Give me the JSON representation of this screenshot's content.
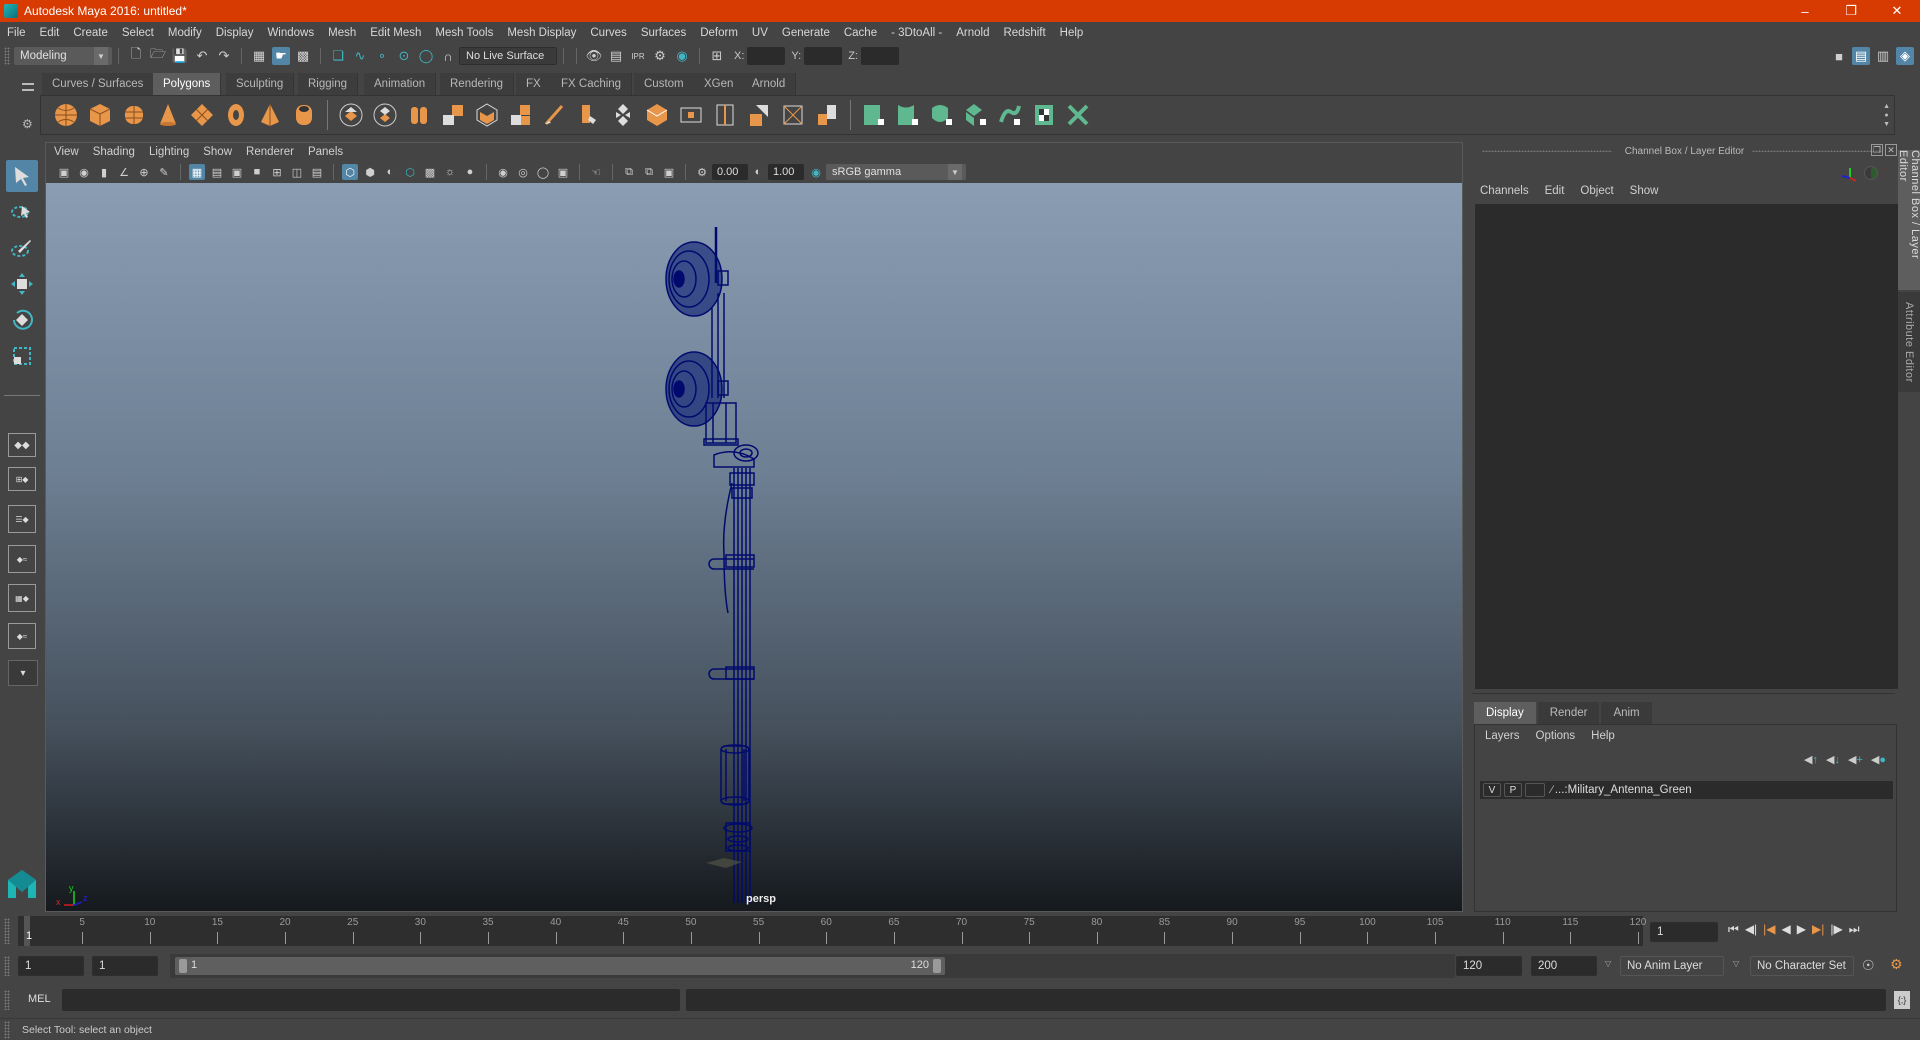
{
  "window": {
    "title": "Autodesk Maya 2016: untitled*",
    "controls": [
      "minimize",
      "restore",
      "close"
    ]
  },
  "menubar": [
    "File",
    "Edit",
    "Create",
    "Select",
    "Modify",
    "Display",
    "Windows",
    "Mesh",
    "Edit Mesh",
    "Mesh Tools",
    "Mesh Display",
    "Curves",
    "Surfaces",
    "Deform",
    "UV",
    "Generate",
    "Cache",
    "- 3DtoAll -",
    "Arnold",
    "Redshift",
    "Help"
  ],
  "statusline": {
    "menuset": "Modeling",
    "live_surface": "No Live Surface",
    "x_label": "X:",
    "y_label": "Y:",
    "z_label": "Z:",
    "x_value": "",
    "y_value": "",
    "z_value": ""
  },
  "shelf": {
    "tabs": [
      "Curves / Surfaces",
      "Polygons",
      "Sculpting",
      "Rigging",
      "Animation",
      "Rendering",
      "FX",
      "FX Caching",
      "Custom",
      "XGen",
      "Arnold"
    ],
    "active_tab": "Polygons",
    "icons": [
      "poly-sphere",
      "poly-cube",
      "poly-cylinder",
      "poly-cone",
      "poly-plane",
      "poly-torus",
      "poly-pyramid",
      "poly-pipe",
      "combine",
      "separate",
      "smooth",
      "extract",
      "booleans",
      "average-vertices",
      "bridge",
      "multi-cut",
      "target-weld",
      "bevel",
      "extrude",
      "insert-edge-loop",
      "offset-edge-loop",
      "connect",
      "fill-hole",
      "uv-planar",
      "uv-cylindrical",
      "uv-spherical",
      "uv-automatic",
      "uv-unfold",
      "uv-checker",
      "uv-layout"
    ],
    "accent_orange": "#e8964a",
    "accent_green": "#5fb88f"
  },
  "toolbox": {
    "tools": [
      "select-tool",
      "lasso-tool",
      "paint-select-tool",
      "move-tool",
      "rotate-tool",
      "scale-tool"
    ],
    "active_tool": "select-tool"
  },
  "viewport": {
    "menu": [
      "View",
      "Shading",
      "Lighting",
      "Show",
      "Renderer",
      "Panels"
    ],
    "exposure": "0.00",
    "gamma": "1.00",
    "color_space": "sRGB gamma",
    "camera_label": "persp",
    "axis": {
      "x": "x",
      "y": "y",
      "z": "z"
    },
    "wire_color": "#000a6e"
  },
  "channel_box": {
    "title": "Channel Box / Layer Editor",
    "menu": [
      "Channels",
      "Edit",
      "Object",
      "Show"
    ]
  },
  "layer_editor": {
    "tabs": [
      "Display",
      "Render",
      "Anim"
    ],
    "active_tab": "Display",
    "menu": [
      "Layers",
      "Options",
      "Help"
    ],
    "layers": [
      {
        "visible": "V",
        "playback": "P",
        "name": "...:Military_Antenna_Green"
      }
    ]
  },
  "side_tabs": [
    "Channel Box / Layer Editor",
    "Attribute Editor"
  ],
  "timeline": {
    "ticks": [
      5,
      10,
      15,
      20,
      25,
      30,
      35,
      40,
      45,
      50,
      55,
      60,
      65,
      70,
      75,
      80,
      85,
      90,
      95,
      100,
      105,
      110,
      115,
      120
    ],
    "min": 1,
    "max": 120,
    "current_frame_marker": "1",
    "current_frame": "1"
  },
  "range": {
    "start_time": "1",
    "playback_start": "1",
    "slider_start": "1",
    "slider_end": "120",
    "playback_end": "120",
    "end_time": "200",
    "anim_layer": "No Anim Layer",
    "character_set": "No Character Set"
  },
  "command_line": {
    "label": "MEL",
    "input": "",
    "result": ""
  },
  "help_line": "Select Tool: select an object"
}
